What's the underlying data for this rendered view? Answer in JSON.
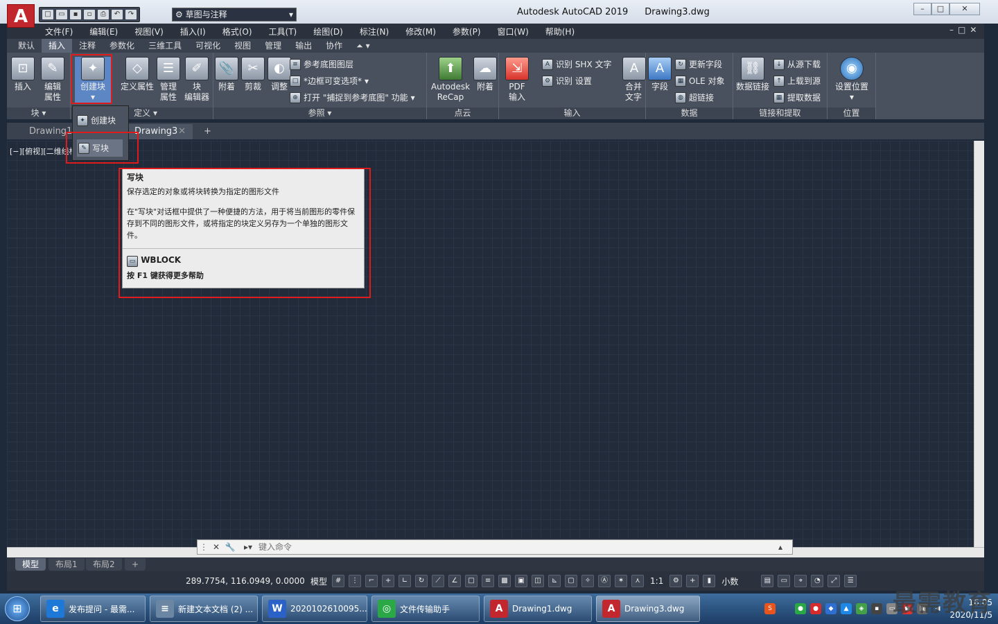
{
  "window": {
    "app_title": "Autodesk AutoCAD 2019",
    "file_title": "Drawing3.dwg",
    "logo_letter": "A"
  },
  "workspace": {
    "label": "草图与注释"
  },
  "menu": [
    "文件(F)",
    "编辑(E)",
    "视图(V)",
    "插入(I)",
    "格式(O)",
    "工具(T)",
    "绘图(D)",
    "标注(N)",
    "修改(M)",
    "参数(P)",
    "窗口(W)",
    "帮助(H)"
  ],
  "ribbon_tabs": [
    "默认",
    "插入",
    "注释",
    "参数化",
    "三维工具",
    "可视化",
    "视图",
    "管理",
    "输出",
    "协作"
  ],
  "ribbon_active_tab": "插入",
  "block_panel": {
    "title": "块",
    "insert": "插入",
    "edit_attr_1": "编辑",
    "edit_attr_2": "属性",
    "create": "创建块"
  },
  "blockdef_panel": {
    "title": "定义",
    "define_attr": "定义属性",
    "manage_1": "管理",
    "manage_2": "属性",
    "editor_1": "块",
    "editor_2": "编辑器"
  },
  "reference_panel": {
    "title": "参照",
    "attach": "附着",
    "clip": "剪裁",
    "adjust": "调整",
    "layers": "参考底图图层",
    "frame": "*边框可变选项*",
    "snap": "打开 \"捕捉到参考底图\" 功能"
  },
  "pointcloud_panel": {
    "title": "点云",
    "recap_1": "Autodesk",
    "recap_2": "ReCap",
    "attach": "附着"
  },
  "import_panel": {
    "title": "输入",
    "pdf_1": "PDF",
    "pdf_2": "输入",
    "shx": "识别 SHX 文字",
    "settings": "识别 设置",
    "merge_1": "合并",
    "merge_2": "文字"
  },
  "data_panel": {
    "title": "数据",
    "field": "字段",
    "update": "更新字段",
    "ole": "OLE 对象",
    "hyperlink": "超链接"
  },
  "link_panel": {
    "title": "链接和提取",
    "datalink": "数据链接",
    "download": "从源下载",
    "upload": "上载到源",
    "extract": "提取数据"
  },
  "location_panel": {
    "title": "位置",
    "set": "设置位置"
  },
  "dropdown": {
    "create": "创建块",
    "write": "写块"
  },
  "doc_tabs": [
    "Drawing1*",
    "Drawing3"
  ],
  "view_label": "[−][俯视][二维线框]",
  "tooltip": {
    "title": "写块",
    "summary": "保存选定的对象或将块转换为指定的图形文件",
    "detail": "在\"写块\"对话框中提供了一种便捷的方法，用于将当前图形的零件保存到不同的图形文件，或将指定的块定义另存为一个单独的图形文件。",
    "command": "WBLOCK",
    "help": "按 F1 键获得更多帮助"
  },
  "command_line": {
    "placeholder": "键入命令"
  },
  "layout_tabs": [
    "模型",
    "布局1",
    "布局2"
  ],
  "status": {
    "coords": "289.7754, 116.0949, 0.0000",
    "model": "模型",
    "scale": "1:1",
    "units": "小数"
  },
  "taskbar": [
    {
      "label": "发布提问 - 最需...",
      "icon": "e",
      "color": "#1e78d7"
    },
    {
      "label": "新建文本文档 (2) ...",
      "icon": "≡",
      "color": "#6b86a3"
    },
    {
      "label": "2020102610095...",
      "icon": "W",
      "color": "#2b62c7"
    },
    {
      "label": "文件传输助手",
      "icon": "◎",
      "color": "#2aa845"
    },
    {
      "label": "Drawing1.dwg",
      "icon": "A",
      "color": "#c2272d"
    },
    {
      "label": "Drawing3.dwg",
      "icon": "A",
      "color": "#c2272d"
    }
  ],
  "clock": {
    "time": "16:05",
    "date": "2020/11/5"
  },
  "watermark": "最需教育"
}
